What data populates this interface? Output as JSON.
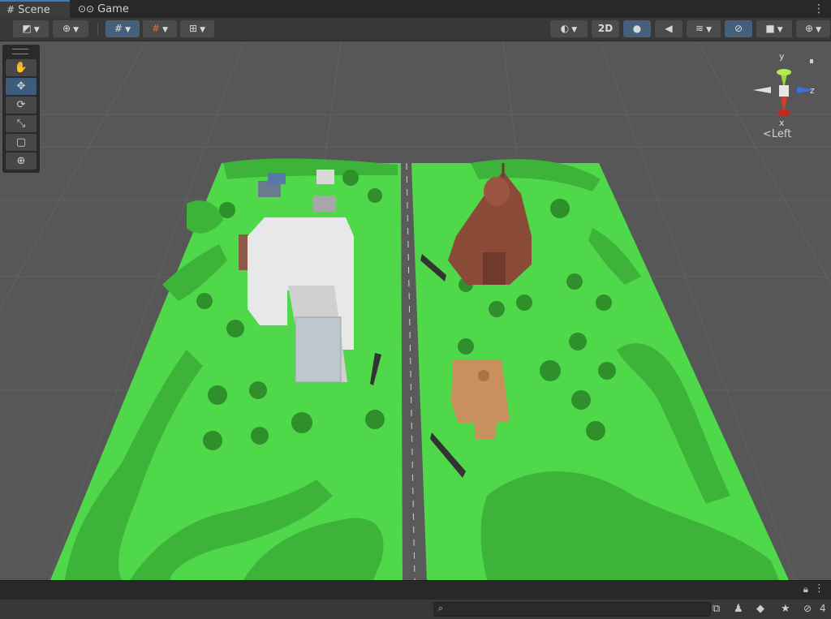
{
  "tabs": [
    {
      "label": "Scene",
      "icon": "grid-icon",
      "active": true
    },
    {
      "label": "Game",
      "icon": "gamepad-icon",
      "active": false
    }
  ],
  "toolbar": {
    "draw_mode_icon": "draw-mode-icon",
    "global_icon": "globe-icon",
    "grid_snap_icon": "grid-snap-icon",
    "increment_snap_icon": "increment-snap-icon",
    "ruler_icon": "ruler-icon",
    "shading_icon": "shading-icon",
    "btn_2d": "2D",
    "lighting_icon": "lightbulb-icon",
    "audio_icon": "audio-icon",
    "effects_icon": "effects-icon",
    "visibility_icon": "hidden-eye-icon",
    "camera_icon": "camera-icon",
    "gizmos_icon": "gizmos-icon"
  },
  "tools": [
    {
      "name": "hand-tool",
      "glyph": "✋",
      "active": false
    },
    {
      "name": "move-tool",
      "glyph": "✥",
      "active": true
    },
    {
      "name": "rotate-tool",
      "glyph": "⟳",
      "active": false
    },
    {
      "name": "scale-tool",
      "glyph": "⤡",
      "active": false
    },
    {
      "name": "rect-tool",
      "glyph": "▢",
      "active": false
    },
    {
      "name": "transform-tool",
      "glyph": "⊕",
      "active": false
    }
  ],
  "gizmo": {
    "y": "y",
    "z": "z",
    "x": "x",
    "view": "Left",
    "view_arrow": "<"
  },
  "status": {
    "hidden_count": "4"
  },
  "colors": {
    "accent": "#3a79bb",
    "grass": "#4fd84a",
    "road": "#595959"
  }
}
